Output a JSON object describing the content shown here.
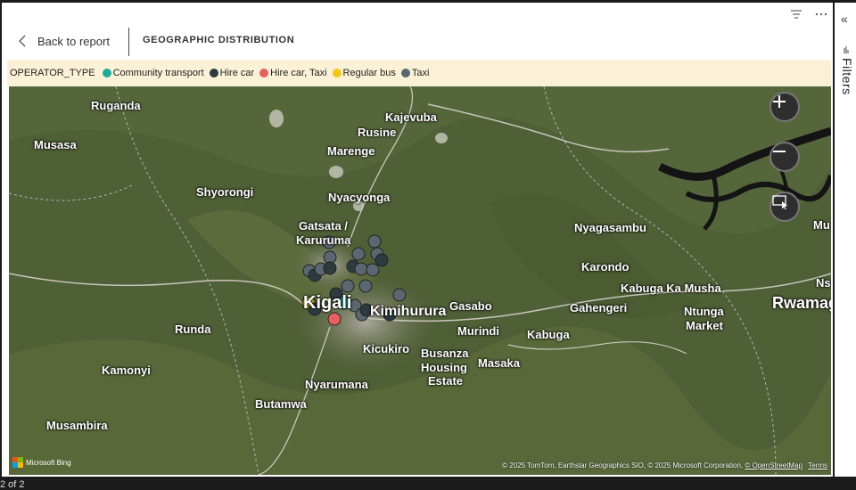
{
  "report": {
    "back_label": "Back to report",
    "title": "GEOGRAPHIC DISTRIBUTION"
  },
  "legend": {
    "title": "OPERATOR_TYPE",
    "items": [
      {
        "label": "Community transport",
        "color": "#1aab9b"
      },
      {
        "label": "Hire car",
        "color": "#2d3a3f"
      },
      {
        "label": "Hire car, Taxi",
        "color": "#e66060"
      },
      {
        "label": "Regular bus",
        "color": "#f2c811"
      },
      {
        "label": "Taxi",
        "color": "#5a6670"
      }
    ]
  },
  "map": {
    "places": {
      "ruganda": "Ruganda",
      "kajevuba": "Kajevuba",
      "rusine": "Rusine",
      "musasa": "Musasa",
      "marenge": "Marenge",
      "shyorongi": "Shyorongi",
      "nyacyonga": "Nyacyonga",
      "gatsata": "Gatsata /",
      "karuruma": "Karuruma",
      "nyagasambu": "Nyagasambu",
      "karondo": "Karondo",
      "kabuga_ka_musha": "Kabuga Ka Musha",
      "gahengeri": "Gahengeri",
      "ntunga": "Ntunga",
      "market": "Market",
      "rwamagana": "Rwamaga",
      "mu": "Mu",
      "ns": "Ns",
      "kigali": "Kigali",
      "kicukiro_ya": "Kimihurura",
      "gasabo": "Gasabo",
      "runda": "Runda",
      "murindi": "Murindi",
      "kabuga": "Kabuga",
      "kicukiro": "Kicukiro",
      "busanza": "Busanza",
      "housing": "Housing",
      "estate": "Estate",
      "masaka": "Masaka",
      "kamonyi": "Kamonyi",
      "nyarumana": "Nyarumana",
      "butamwa": "Butamwa",
      "musambira": "Musambira"
    },
    "bing_label": "Microsoft Bing",
    "attribution": "© 2025 TomTom, Earthstar Geographics SIO, © 2025 Microsoft Corporation,",
    "osm_link": "© OpenStreetMap",
    "terms_link": "Terms",
    "bing_colors": [
      "#f25022",
      "#7fba00",
      "#00a4ef",
      "#ffb900"
    ]
  },
  "filters": {
    "label": "Filters",
    "collapse_glyph": "«"
  },
  "status": {
    "page_text": "2 of 2"
  }
}
